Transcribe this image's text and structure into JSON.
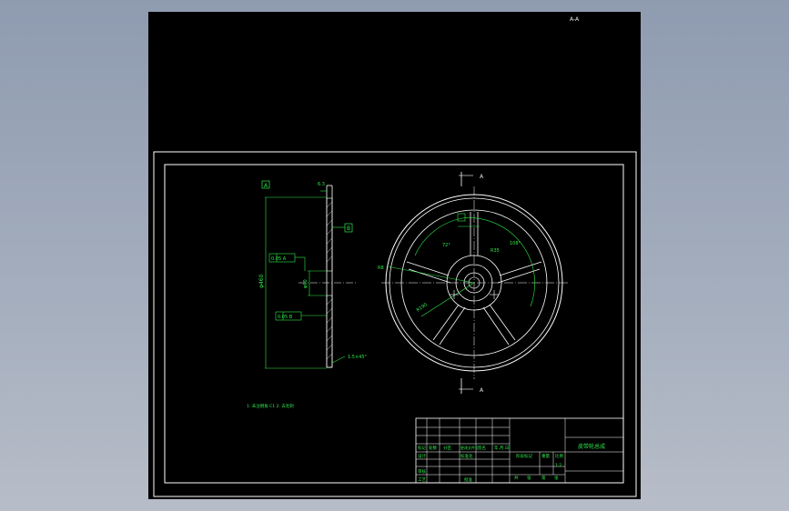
{
  "viewport": {
    "top_label": "A-A"
  },
  "section_view": {
    "datum_a": "A",
    "datum_b": "B",
    "roughness_top": "6.3",
    "tolerance_frame_1": "0.05  A",
    "tolerance_frame_2": "0.05  B",
    "dim_outer_diameter": "φ460",
    "dim_bore": "φ60",
    "chamfer": "1.5×45°"
  },
  "front_view": {
    "section_mark_top": "A",
    "section_mark_bottom": "A",
    "dim_angle_1": "72°",
    "dim_angle_2": "108°",
    "dim_radius": "R35",
    "dim_spoke": "R190",
    "dim_rim": "R8"
  },
  "notes": {
    "tech_requirements": "1. 未注倒角 C1   2. 去毛刺"
  },
  "title_block": {
    "header_row": [
      "标记",
      "处数",
      "分区",
      "更改文件号",
      "签名",
      "年.月.日"
    ],
    "row_design": [
      "设计",
      "",
      "",
      "标准化",
      "",
      ""
    ],
    "row_review": [
      "审核",
      "",
      "",
      "",
      "",
      ""
    ],
    "row_process": [
      "工艺",
      "",
      "",
      "批准",
      "",
      ""
    ],
    "stage_label": "阶段标记",
    "weight_label": "重量",
    "scale_label": "比例",
    "scale_value": "1:2",
    "sheet_info": [
      "共",
      "张",
      "第",
      "张"
    ],
    "drawing_title": "皮带轮总成",
    "material": "HT200"
  },
  "colors": {
    "line": "#ffffff",
    "annotation": "#2ee84a",
    "background": "#000000"
  }
}
